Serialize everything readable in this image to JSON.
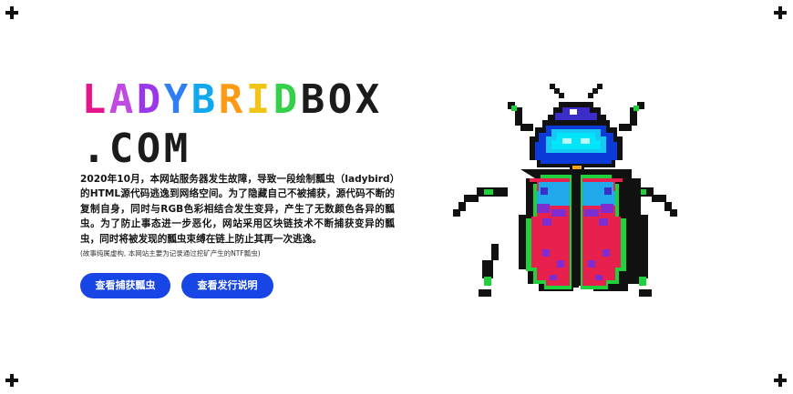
{
  "logo": {
    "line1": [
      "L",
      "A",
      "D",
      "Y",
      "B",
      "R",
      "I",
      "D",
      "B",
      "O",
      "X"
    ],
    "line1_colors": [
      "#e4148a",
      "#c14ae0",
      "#9a38e8",
      "#2f7ff2",
      "#12a8ee",
      "#ff9a16",
      "#f2c418",
      "#33d04a",
      "#1b1b1b",
      "#1b1b1b",
      "#1b1b1b"
    ],
    "line2": [
      ".",
      "C",
      "O",
      "M"
    ],
    "line2_color": "#1b1b1b"
  },
  "story": "2020年10月，本网站服务器发生故障，导致一段绘制瓢虫（ladybird）的HTML源代码逃逸到网络空间。为了隐藏自己不被捕获，源代码不断的复制自身，同时与RGB色彩相结合发生变异，产生了无数颜色各异的瓢虫。为了防止事态进一步恶化，网站采用区块链技术不断捕获变异的瓢虫，同时将被发现的瓢虫束缚在链上防止其再一次逃逸。",
  "note": "(故事纯属虚构, 本网站主要为记录通过挖矿产生的NTF瓢虫)",
  "buttons": {
    "catch": "查看捕获瓢虫",
    "issue": "查看发行说明"
  },
  "colors": {
    "button": "#1745e6",
    "bug_wing": "#e8204e",
    "bug_head": "#00e5f8",
    "bug_legs": "#1fd23b",
    "bug_spots": "#7e2ed0"
  },
  "icons": [
    "plus-corner-icon",
    "ladybug-pixel-art"
  ]
}
